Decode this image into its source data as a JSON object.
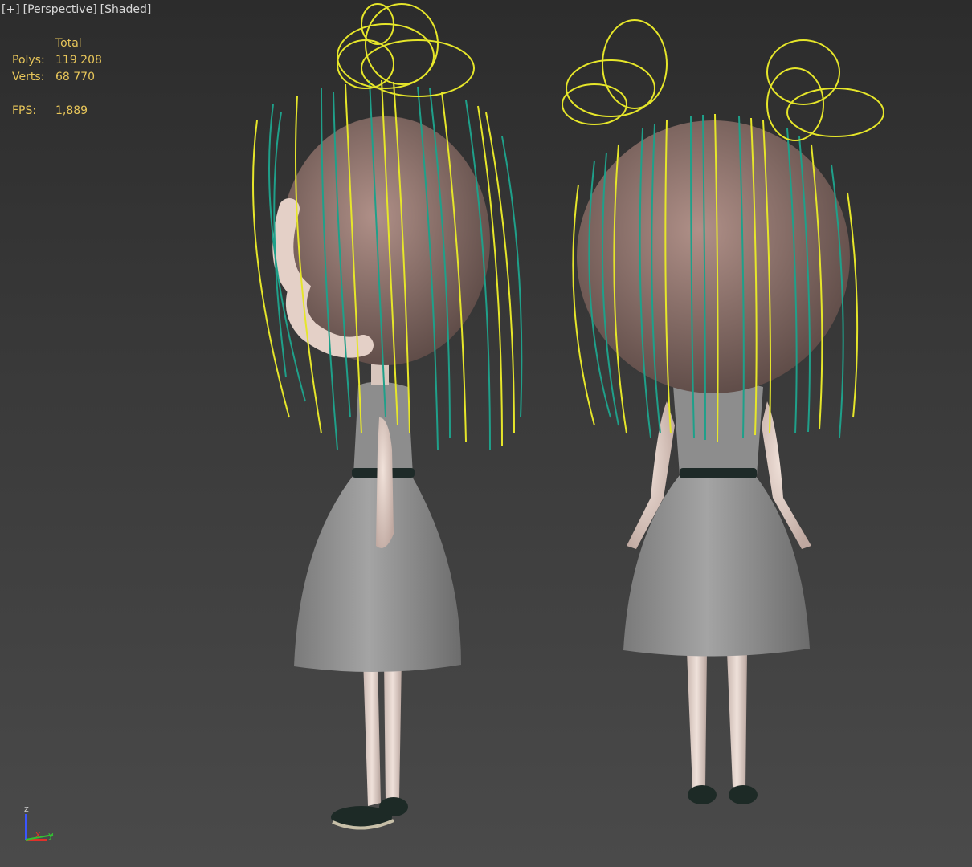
{
  "viewport": {
    "label_plus": "[+]",
    "label_view": "[Perspective]",
    "label_mode": "[Shaded]"
  },
  "stats": {
    "header": "Total",
    "polys_label": "Polys:",
    "polys_value": "119 208",
    "verts_label": "Verts:",
    "verts_value": "68 770",
    "fps_label": "FPS:",
    "fps_value": "1,889"
  },
  "axis": {
    "z": "z",
    "x": "x",
    "y": "y"
  },
  "colors": {
    "stats_text": "#e8c65a",
    "label_text": "#d8d8d8",
    "hair_yellow": "#e6e62a",
    "hair_teal": "#1fa08a",
    "dress": "#8f8f8f",
    "skin": "#e8d8cf"
  }
}
